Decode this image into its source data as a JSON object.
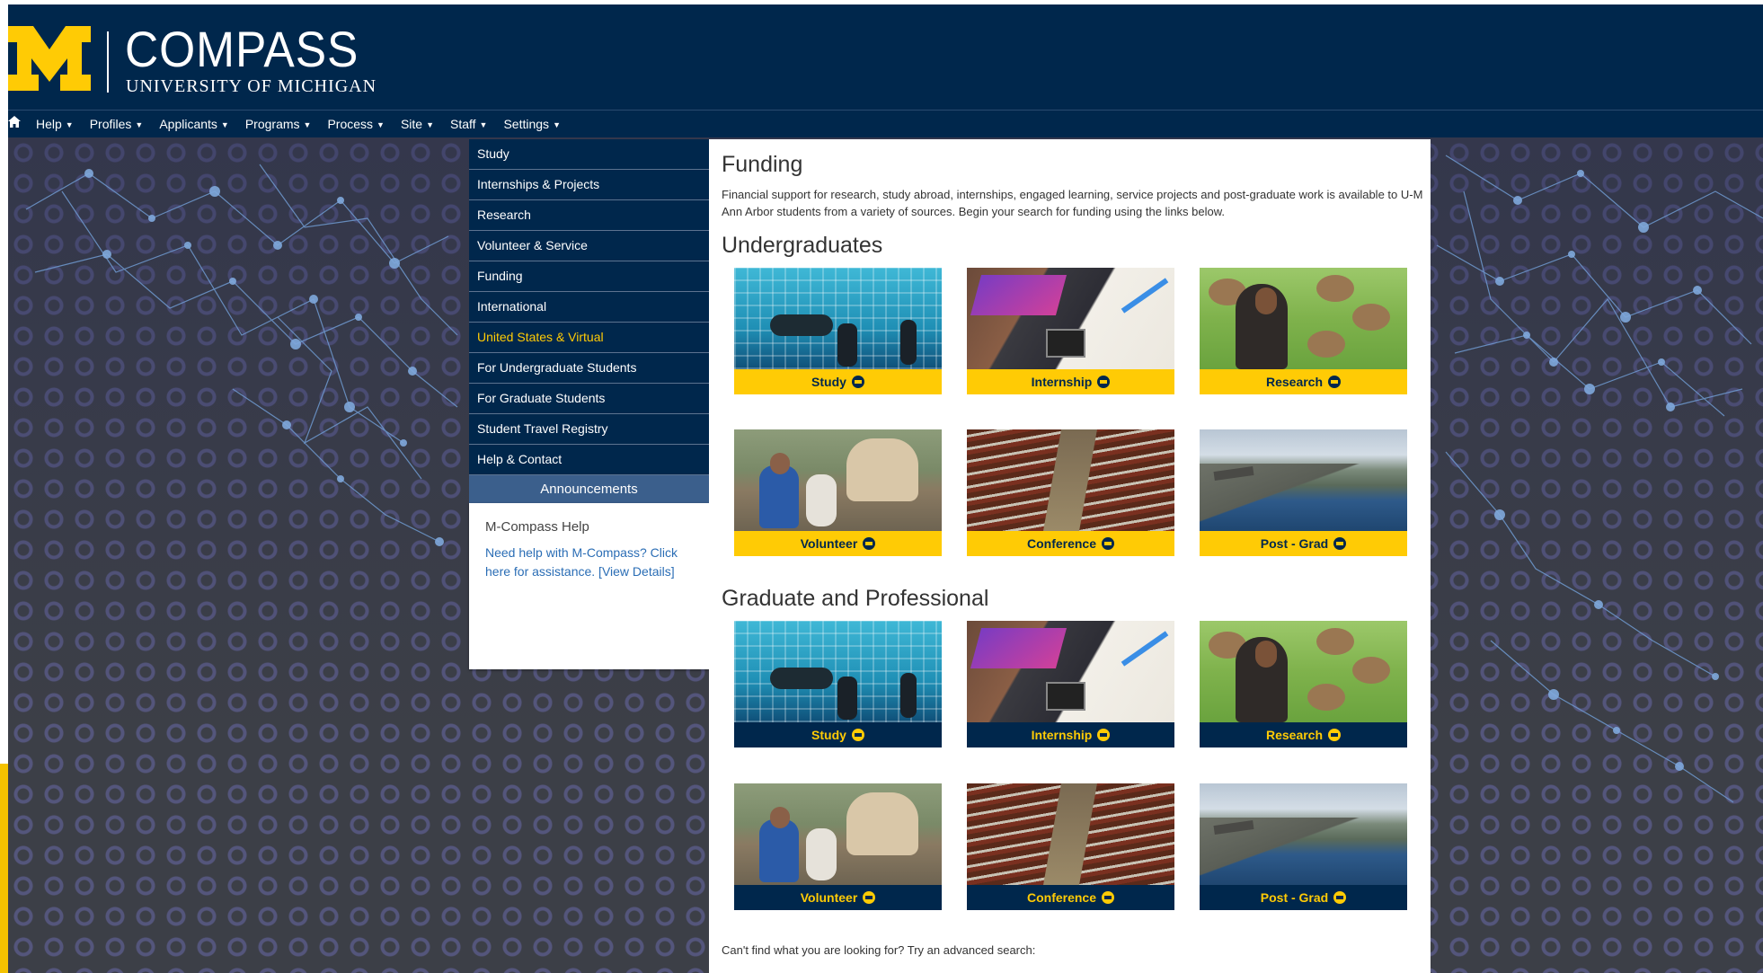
{
  "brand": {
    "name": "COMPASS",
    "subtitle": "UNIVERSITY OF MICHIGAN",
    "colors": {
      "navy": "#00274c",
      "maize": "#ffcb05",
      "announce": "#3b5f8c"
    }
  },
  "nav": {
    "home_icon": "home-icon",
    "items": [
      {
        "label": "Help"
      },
      {
        "label": "Profiles"
      },
      {
        "label": "Applicants"
      },
      {
        "label": "Programs"
      },
      {
        "label": "Process"
      },
      {
        "label": "Site"
      },
      {
        "label": "Staff"
      },
      {
        "label": "Settings"
      }
    ]
  },
  "sidebar": {
    "items": [
      {
        "label": "Study"
      },
      {
        "label": "Internships & Projects"
      },
      {
        "label": "Research"
      },
      {
        "label": "Volunteer & Service"
      },
      {
        "label": "Funding"
      },
      {
        "label": "International"
      },
      {
        "label": "United States & Virtual",
        "active": true
      },
      {
        "label": "For Undergraduate Students"
      },
      {
        "label": "For Graduate Students"
      },
      {
        "label": "Student Travel Registry"
      },
      {
        "label": "Help & Contact"
      }
    ],
    "announcements": {
      "heading": "Announcements",
      "title": "M-Compass Help",
      "link_text": "Need help with M-Compass? Click here for assistance. [View Details]"
    }
  },
  "main": {
    "title": "Funding",
    "intro": "Financial support for research, study abroad, internships, engaged learning, service projects and post-graduate work is available to U-M Ann Arbor students from a variety of sources. Begin your search for funding using the links below.",
    "undergrad": {
      "heading": "Undergraduates",
      "tiles": [
        {
          "label": "Study"
        },
        {
          "label": "Internship"
        },
        {
          "label": "Research"
        },
        {
          "label": "Volunteer"
        },
        {
          "label": "Conference"
        },
        {
          "label": "Post - Grad"
        }
      ]
    },
    "graduate": {
      "heading": "Graduate and Professional",
      "tiles": [
        {
          "label": "Study"
        },
        {
          "label": "Internship"
        },
        {
          "label": "Research"
        },
        {
          "label": "Volunteer"
        },
        {
          "label": "Conference"
        },
        {
          "label": "Post - Grad"
        }
      ]
    },
    "footer_text": "Can't find what you are looking for? Try an advanced search:"
  }
}
